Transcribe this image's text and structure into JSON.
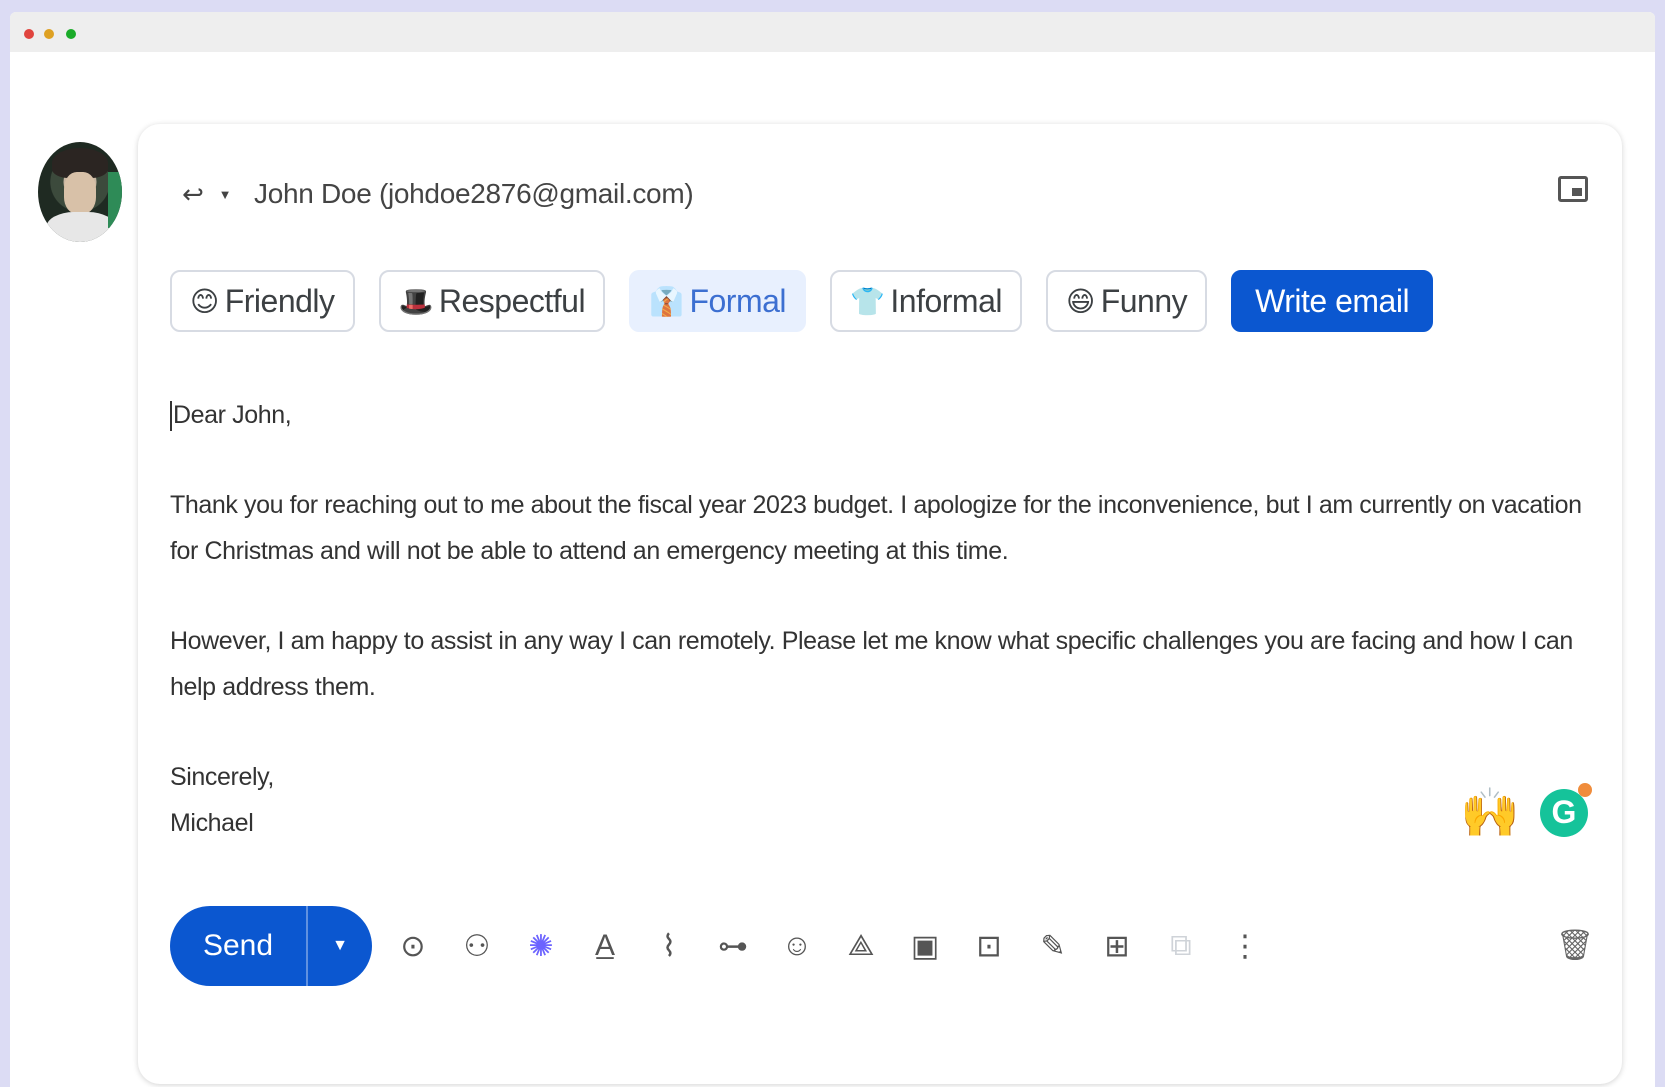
{
  "recipient": "John Doe (johdoe2876@gmail.com)",
  "tones": [
    {
      "label": "Friendly",
      "emoji": "😊"
    },
    {
      "label": "Respectful",
      "emoji": "🎩"
    },
    {
      "label": "Formal",
      "emoji": "👔"
    },
    {
      "label": "Informal",
      "emoji": "👕"
    },
    {
      "label": "Funny",
      "emoji": "😄"
    }
  ],
  "selected_tone": "Formal",
  "write_email_label": "Write email",
  "email": {
    "greeting": "Dear John,",
    "paragraph1": "Thank you for reaching out to me about the fiscal year 2023 budget. I apologize for the inconvenience, but I am currently on vacation for Christmas and will not be able to attend an emergency meeting at this time.",
    "paragraph2": "However, I am happy to assist in any way I can remotely. Please let me know what specific challenges you are facing and how I can help address them.",
    "closing": "Sincerely,",
    "signature": "Michael"
  },
  "send_label": "Send",
  "icons": {
    "reply": "↩",
    "caret": "▼",
    "hands": "🙌",
    "grammarly": "G",
    "send_more": "▼",
    "tools": [
      "⊙",
      "⚇",
      "✺",
      "A̲",
      "⌇",
      "⊶",
      "☺",
      "⟁",
      "▣",
      "⊡",
      "✎",
      "⊞",
      "⧉",
      "⋮"
    ],
    "trash": "🗑"
  },
  "colors": {
    "accent": "#0b57d0",
    "selected_chip_bg": "#e8f0fe",
    "page_bg": "#dcdcf4"
  }
}
